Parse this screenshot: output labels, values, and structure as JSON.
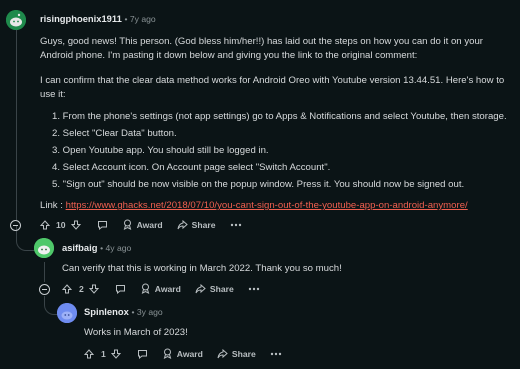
{
  "comments": [
    {
      "username": "risingphoenix1911",
      "age": "7y ago",
      "intro": "Guys, good news! This person. (God bless him/her!!) has laid out the steps on how you can do it on your Android phone. I'm pasting it down below and giving you the link to the original comment:",
      "confirm": "I can confirm that the clear data method works for Android Oreo with Youtube version 13.44.51. Here's how to use it:",
      "steps": [
        "1.  From the phone's settings (not app settings) go to Apps & Notifications and select Youtube, then storage.",
        "2.  Select \"Clear Data\" button.",
        "3.  Open Youtube app. You should still be logged in.",
        "4.  Select Account icon. On Account page select \"Switch Account\".",
        "5.  \"Sign out\" should be now visible on the popup window. Press it. You should now be signed out."
      ],
      "link_label": "Link : ",
      "link_url": "https://www.ghacks.net/2018/07/10/you-cant-sign-out-of-the-youtube-app-on-android-anymore/",
      "votes": "10",
      "award_label": "Award",
      "share_label": "Share",
      "avatar_color": "#1f8a4c"
    },
    {
      "username": "asifbaig",
      "age": "4y ago",
      "body": "Can verify that this is working in March 2022. Thank you so much!",
      "votes": "2",
      "award_label": "Award",
      "share_label": "Share",
      "avatar_color": "#4fc86a"
    },
    {
      "username": "Spinlenox",
      "age": "3y ago",
      "body": "Works in March of 2023!",
      "votes": "1",
      "award_label": "Award",
      "share_label": "Share",
      "avatar_color": "#6f8cf0"
    }
  ],
  "colors": {
    "background": "#0b1416",
    "link": "#f06050",
    "thread_line": "#3a4448"
  }
}
